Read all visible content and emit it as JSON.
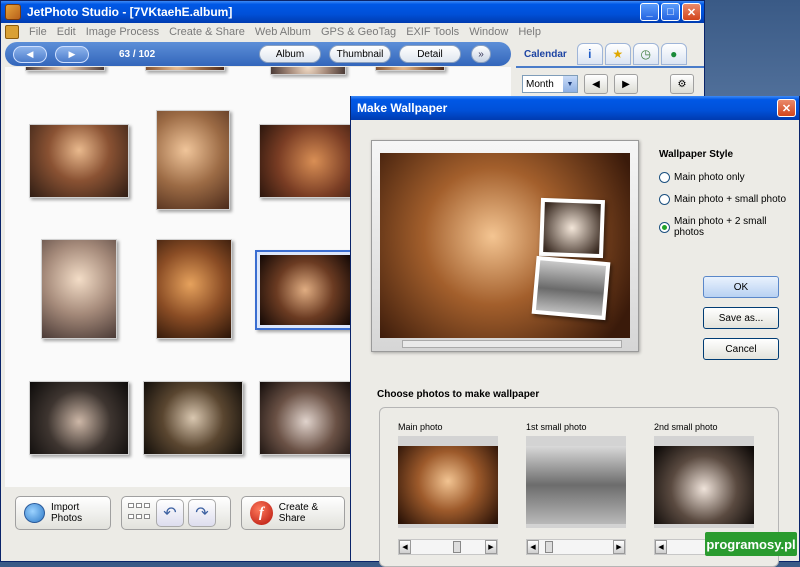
{
  "app": {
    "title": "JetPhoto Studio - [7VKtaehE.album]",
    "menu": [
      "File",
      "Edit",
      "Image Process",
      "Create & Share",
      "Web Album",
      "GPS & GeoTag",
      "EXIF Tools",
      "Window",
      "Help"
    ]
  },
  "navbar": {
    "counter": "63 / 102",
    "tabs": [
      "Album",
      "Thumbnail",
      "Detail"
    ]
  },
  "right_panel": {
    "title": "Calendar",
    "view_select": "Month"
  },
  "bottom_toolbar": {
    "import_label": "Import Photos",
    "create_label": "Create & Share"
  },
  "dialog": {
    "title": "Make Wallpaper",
    "style_title": "Wallpaper Style",
    "styles": [
      {
        "label": "Main photo only",
        "selected": false
      },
      {
        "label": "Main photo + small photo",
        "selected": false
      },
      {
        "label": "Main photo + 2 small photos",
        "selected": true
      }
    ],
    "buttons": {
      "ok": "OK",
      "save": "Save as...",
      "cancel": "Cancel"
    },
    "choose_title": "Choose photos to make wallpaper",
    "slots": [
      "Main photo",
      "1st small photo",
      "2nd small photo"
    ]
  },
  "watermark": "programosy.pl",
  "colors": {
    "titlebar": "#0050d8",
    "selection_radio": "#22a32a",
    "watermark_bg": "#2a9b2f"
  }
}
